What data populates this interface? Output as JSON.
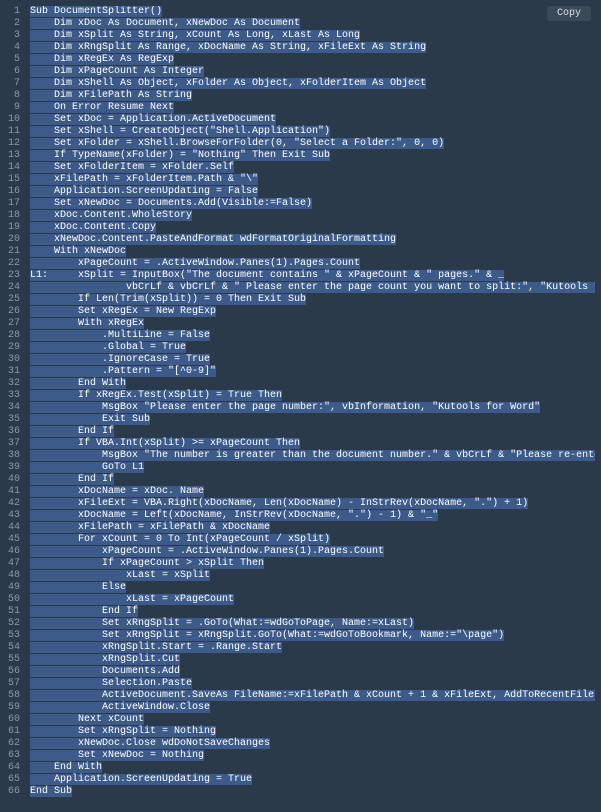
{
  "copy_label": "Copy",
  "lines": [
    "Sub DocumentSplitter()",
    "    Dim xDoc As Document, xNewDoc As Document",
    "    Dim xSplit As String, xCount As Long, xLast As Long",
    "    Dim xRngSplit As Range, xDocName As String, xFileExt As String",
    "    Dim xRegEx As RegExp",
    "    Dim xPageCount As Integer",
    "    Dim xShell As Object, xFolder As Object, xFolderItem As Object",
    "    Dim xFilePath As String",
    "    On Error Resume Next",
    "    Set xDoc = Application.ActiveDocument",
    "    Set xShell = CreateObject(\"Shell.Application\")",
    "    Set xFolder = xShell.BrowseForFolder(0, \"Select a Folder:\", 0, 0)",
    "    If TypeName(xFolder) = \"Nothing\" Then Exit Sub",
    "    Set xFolderItem = xFolder.Self",
    "    xFilePath = xFolderItem.Path & \"\\\"",
    "    Application.ScreenUpdating = False",
    "    Set xNewDoc = Documents.Add(Visible:=False)",
    "    xDoc.Content.WholeStory",
    "    xDoc.Content.Copy",
    "    xNewDoc.Content.PasteAndFormat wdFormatOriginalFormatting",
    "    With xNewDoc",
    "        xPageCount = .ActiveWindow.Panes(1).Pages.Count",
    "L1:     xSplit = InputBox(\"The document contains \" & xPageCount & \" pages.\" & _",
    "                vbCrLf & vbCrLf & \" Please enter the page count you want to split:\", \"Kutools for Word\", xSplit)",
    "        If Len(Trim(xSplit)) = 0 Then Exit Sub",
    "        Set xRegEx = New RegExp",
    "        With xRegEx",
    "            .MultiLine = False",
    "            .Global = True",
    "            .IgnoreCase = True",
    "            .Pattern = \"[^0-9]\"",
    "        End With",
    "        If xRegEx.Test(xSplit) = True Then",
    "            MsgBox \"Please enter the page number:\", vbInformation, \"Kutools for Word\"",
    "            Exit Sub",
    "        End If",
    "        If VBA.Int(xSplit) >= xPageCount Then",
    "            MsgBox \"The number is greater than the document number.\" & vbCrLf & \"Please re-enter\", vbInformation, \"Kutools for Wor",
    "            GoTo L1",
    "        End If",
    "        xDocName = xDoc. Name",
    "        xFileExt = VBA.Right(xDocName, Len(xDocName) - InStrRev(xDocName, \".\") + 1)",
    "        xDocName = Left(xDocName, InStrRev(xDocName, \".\") - 1) & \"_\"",
    "        xFilePath = xFilePath & xDocName",
    "        For xCount = 0 To Int(xPageCount / xSplit)",
    "            xPageCount = .ActiveWindow.Panes(1).Pages.Count",
    "            If xPageCount > xSplit Then",
    "                xLast = xSplit",
    "            Else",
    "                xLast = xPageCount",
    "            End If",
    "            Set xRngSplit = .GoTo(What:=wdGoToPage, Name:=xLast)",
    "            Set xRngSplit = xRngSplit.GoTo(What:=wdGoToBookmark, Name:=\"\\page\")",
    "            xRngSplit.Start = .Range.Start",
    "            xRngSplit.Cut",
    "            Documents.Add",
    "            Selection.Paste",
    "            ActiveDocument.SaveAs FileName:=xFilePath & xCount + 1 & xFileExt, AddToRecentFiles:=False",
    "            ActiveWindow.Close",
    "        Next xCount",
    "        Set xRngSplit = Nothing",
    "        xNewDoc.Close wdDoNotSaveChanges",
    "        Set xNewDoc = Nothing",
    "    End With",
    "    Application.ScreenUpdating = True",
    "End Sub"
  ]
}
